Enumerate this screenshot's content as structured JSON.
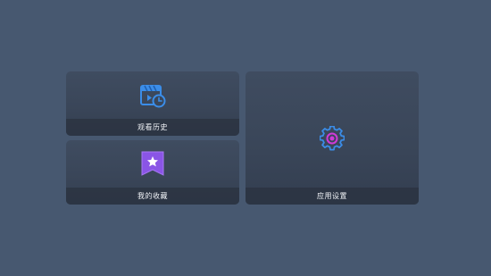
{
  "tiles": {
    "history": {
      "label": "观看历史",
      "icon": "clapperboard-clock-icon",
      "accent": "#3b8de8"
    },
    "favorites": {
      "label": "我的收藏",
      "icon": "bookmark-star-icon",
      "accent": "#8a55e6"
    },
    "settings": {
      "label": "应用设置",
      "icon": "gear-icon",
      "accent": "#3b8de8",
      "accent2": "#d03ad8"
    }
  },
  "colors": {
    "background": "#475870",
    "tile": "#3a4659",
    "label_bar": "#2c3442",
    "text": "#f1f4f8"
  }
}
